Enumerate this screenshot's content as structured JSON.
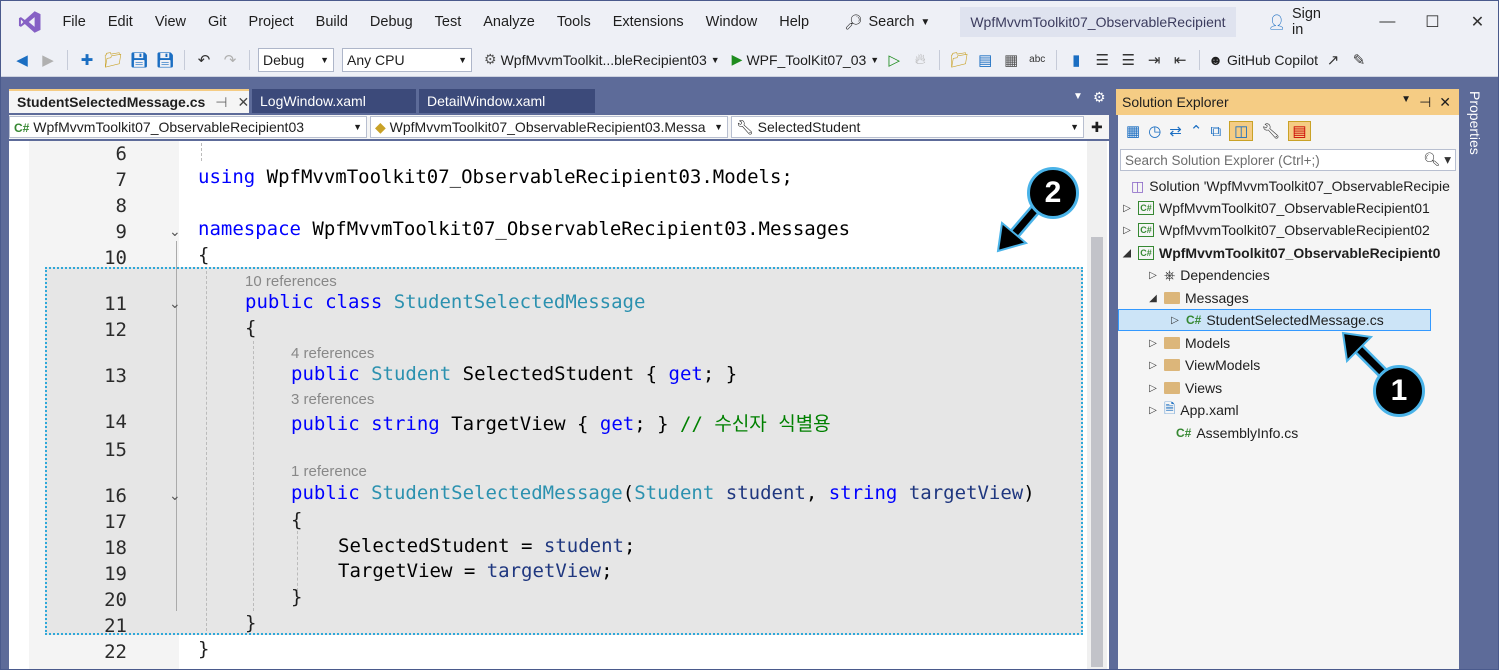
{
  "menu": [
    "File",
    "Edit",
    "View",
    "Git",
    "Project",
    "Build",
    "Debug",
    "Test",
    "Analyze",
    "Tools",
    "Extensions",
    "Window",
    "Help"
  ],
  "search_label": "Search",
  "solution_title": "WpfMvvmToolkit07_ObservableRecipient",
  "signin": "Sign in",
  "toolbar": {
    "config": "Debug",
    "platform": "Any CPU",
    "startup_project": "WpfMvvmToolkit...bleRecipient03",
    "run_target": "WPF_ToolKit07_03",
    "copilot": "GitHub Copilot"
  },
  "doc_tabs": [
    {
      "label": "StudentSelectedMessage.cs",
      "active": true
    },
    {
      "label": "LogWindow.xaml",
      "active": false
    },
    {
      "label": "DetailWindow.xaml",
      "active": false
    }
  ],
  "navbar": {
    "project": "WpfMvvmToolkit07_ObservableRecipient03",
    "type": "WpfMvvmToolkit07_ObservableRecipient03.Messa",
    "member": "SelectedStudent"
  },
  "code": {
    "l6": "6",
    "l7": "7",
    "l7_kw": "using",
    "l7_ns": "WpfMvvmToolkit07_ObservableRecipient03.Models;",
    "l8": "8",
    "l9": "9",
    "l9_kw": "namespace",
    "l9_ns": "WpfMvvmToolkit07_ObservableRecipient03.Messages",
    "l10": "10",
    "l10_txt": "{",
    "lens_class": "10 references",
    "l11": "11",
    "l11_kw": "public class",
    "l11_ty": "StudentSelectedMessage",
    "l12": "12",
    "l12_txt": "{",
    "lens_sel": "4 references",
    "l13": "13",
    "l13_kw": "public",
    "l13_ty": "Student",
    "l13_name": "SelectedStudent {",
    "l13_get": "get",
    "l13_end": "; }",
    "lens_tv": "3 references",
    "l14": "14",
    "l14_kw": "public string",
    "l14_name": "TargetView {",
    "l14_get": "get",
    "l14_end": "; }",
    "l14_cm": "// 수신자 식별용",
    "l15": "15",
    "lens_ctor": "1 reference",
    "l16": "16",
    "l16_kw": "public",
    "l16_ty": "StudentSelectedMessage",
    "l16_p1": "(",
    "l16_ty2": "Student",
    "l16_a1": "student",
    "l16_c": ",",
    "l16_kw2": "string",
    "l16_a2": "targetView",
    "l16_p2": ")",
    "l17": "17",
    "l17_txt": "{",
    "l18": "18",
    "l18_name": "SelectedStudent =",
    "l18_a": "student",
    "l18_end": ";",
    "l19": "19",
    "l19_name": "TargetView =",
    "l19_a": "targetView",
    "l19_end": ";",
    "l20": "20",
    "l20_txt": "}",
    "l21": "21",
    "l21_txt": "}",
    "l22": "22",
    "l22_txt": "}"
  },
  "solution_explorer": {
    "title": "Solution Explorer",
    "search_placeholder": "Search Solution Explorer (Ctrl+;)",
    "items": [
      {
        "label": "Solution 'WpfMvvmToolkit07_ObservableRecipie"
      },
      {
        "label": "WpfMvvmToolkit07_ObservableRecipient01"
      },
      {
        "label": "WpfMvvmToolkit07_ObservableRecipient02"
      },
      {
        "label": "WpfMvvmToolkit07_ObservableRecipient0"
      },
      {
        "label": "Dependencies"
      },
      {
        "label": "Messages"
      },
      {
        "label": "StudentSelectedMessage.cs"
      },
      {
        "label": "Models"
      },
      {
        "label": "ViewModels"
      },
      {
        "label": "Views"
      },
      {
        "label": "App.xaml"
      },
      {
        "label": "AssemblyInfo.cs"
      }
    ]
  },
  "properties_tab": "Properties",
  "callouts": {
    "one": "1",
    "two": "2"
  }
}
